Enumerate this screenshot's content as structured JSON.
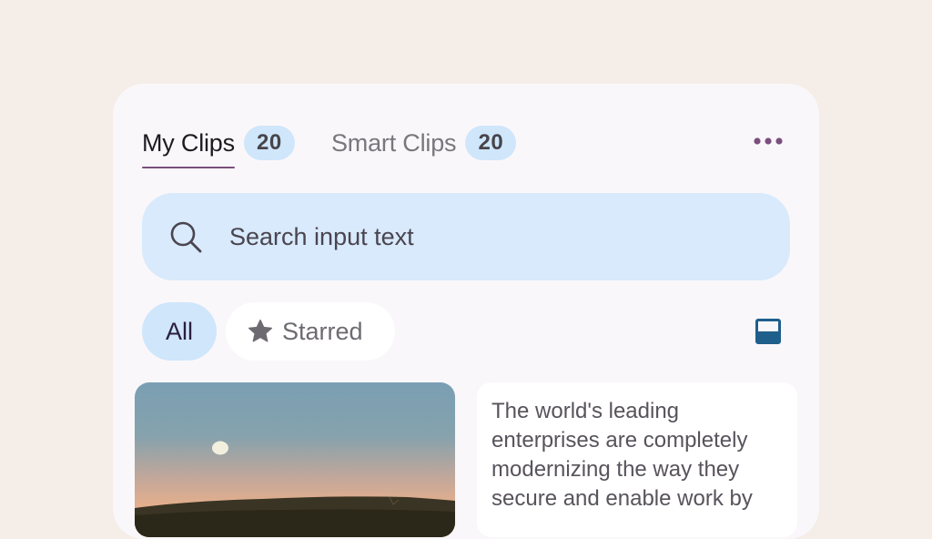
{
  "tabs": [
    {
      "label": "My Clips",
      "count": "20",
      "active": true
    },
    {
      "label": "Smart Clips",
      "count": "20",
      "active": false
    }
  ],
  "more_icon": "more-horizontal-icon",
  "search": {
    "placeholder": "Search input text",
    "icon": "search-icon"
  },
  "filters": {
    "all_label": "All",
    "starred_label": "Starred",
    "starred_icon": "star-icon"
  },
  "layout_icon": "layout-toggle-icon",
  "clips": [
    {
      "type": "image",
      "description_icon": "landscape-moon-image"
    },
    {
      "type": "text",
      "text": "The world's leading enterprises are completely modernizing the way they secure and enable work by"
    }
  ],
  "colors": {
    "accent": "#7a4f7e",
    "badge_bg": "#cfe6fb",
    "search_bg": "#d8eafb",
    "layout_icon": "#1f5f8b"
  }
}
